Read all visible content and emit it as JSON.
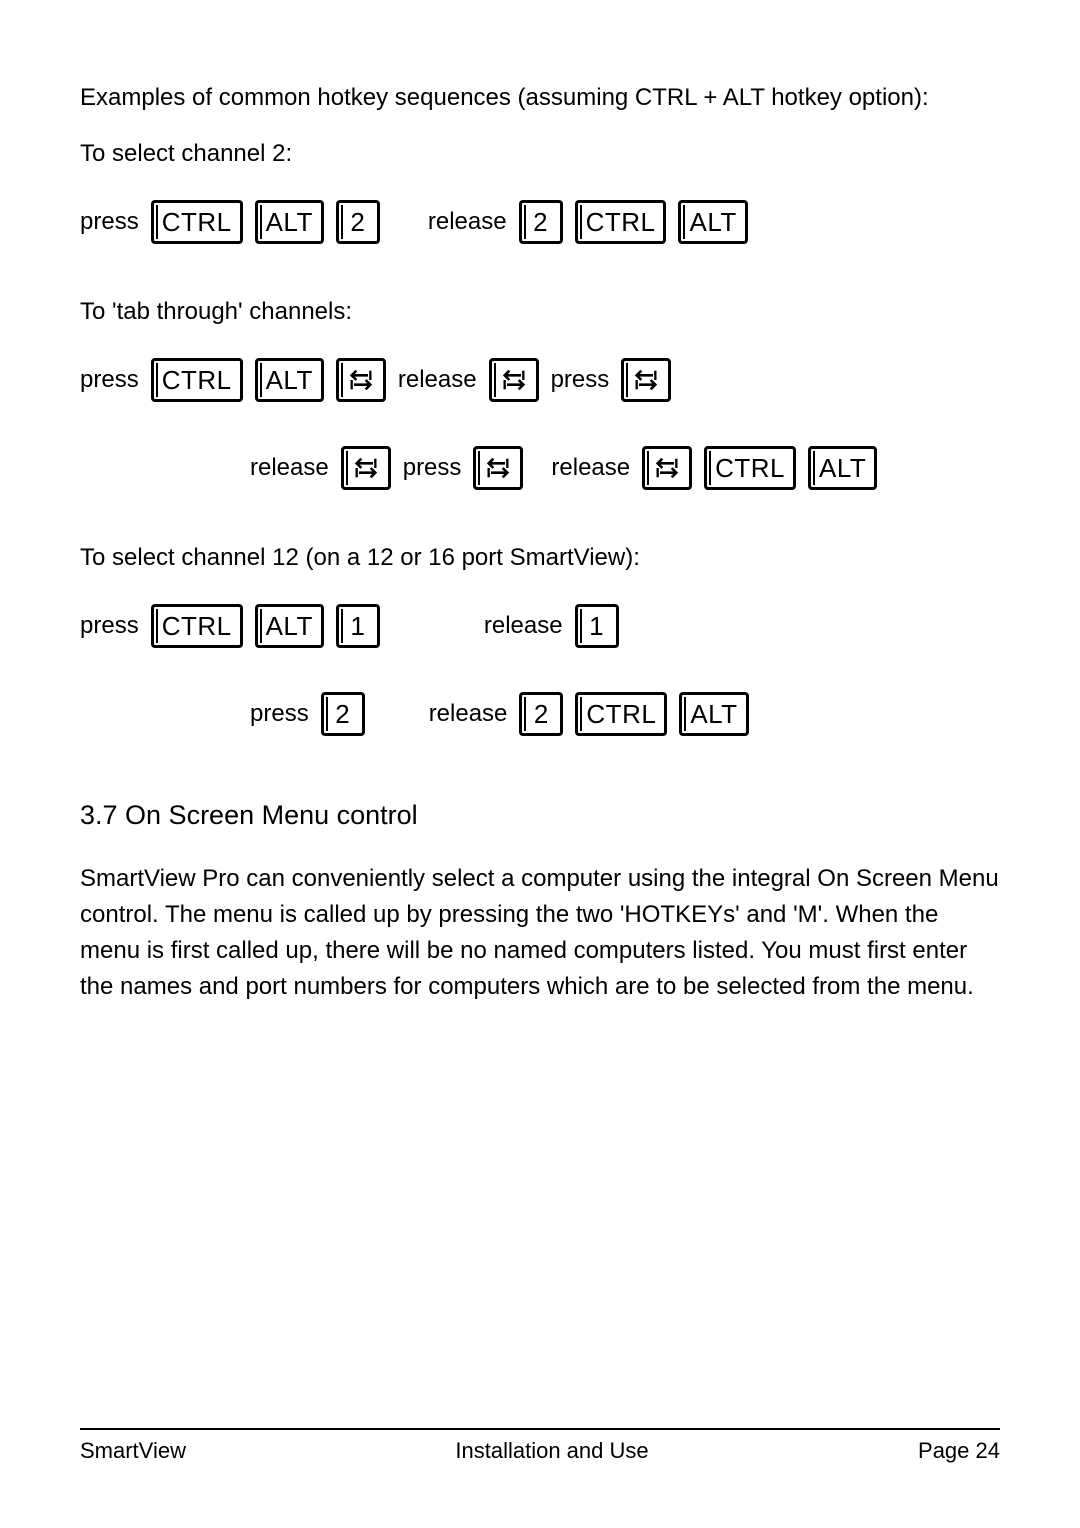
{
  "intro": "Examples of common hotkey sequences (assuming CTRL + ALT hotkey option):",
  "example1_title": "To select channel 2:",
  "example2_title": "To 'tab through' channels:",
  "example3_title": "To select channel 12 (on a 12 or 16 port SmartView):",
  "labels": {
    "press": "press",
    "release": "release"
  },
  "keys": {
    "ctrl": "CTRL",
    "alt": "ALT",
    "k1": "1",
    "k2": "2"
  },
  "section_heading": "3.7 On Screen Menu control",
  "section_body": "SmartView Pro can conveniently select a computer using the integral On Screen Menu control. The menu is called up by pressing the two 'HOTKEYs' and 'M'. When the menu is first called up, there will be no named computers listed. You must first enter the names and port numbers for computers which are to be selected from the menu.",
  "footer": {
    "left": "SmartView",
    "center": "Installation and Use",
    "right": "Page 24"
  }
}
